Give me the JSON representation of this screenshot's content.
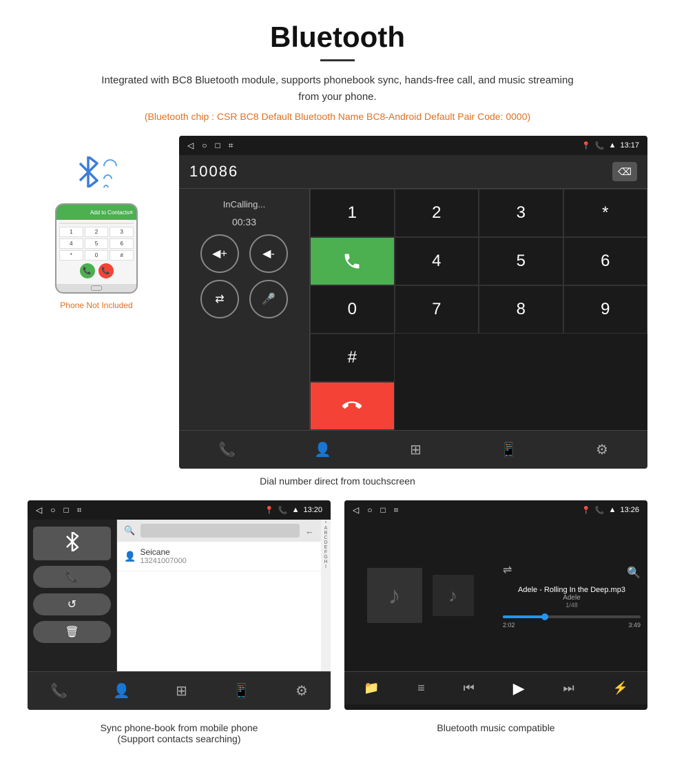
{
  "header": {
    "title": "Bluetooth",
    "description": "Integrated with BC8 Bluetooth module, supports phonebook sync, hands-free call, and music streaming from your phone.",
    "orange_info": "(Bluetooth chip : CSR BC8    Default Bluetooth Name BC8-Android    Default Pair Code: 0000)"
  },
  "phone_mockup": {
    "not_included_label": "Phone Not Included",
    "call_label": "Add to Contacts",
    "dial_keys": [
      "1",
      "2",
      "3",
      "4",
      "5",
      "6",
      "*",
      "0",
      "#"
    ]
  },
  "dialer_screen": {
    "time": "13:17",
    "number": "10086",
    "call_status": "InCalling...",
    "call_timer": "00:33",
    "keys": [
      "1",
      "2",
      "3",
      "*",
      "4",
      "5",
      "6",
      "0",
      "7",
      "8",
      "9",
      "#"
    ],
    "caption": "Dial number direct from touchscreen"
  },
  "phonebook_screen": {
    "time": "13:20",
    "search_placeholder": "Search",
    "contact_name": "Seicane",
    "contact_number": "13241007000",
    "alphabet": [
      "*",
      "A",
      "B",
      "C",
      "D",
      "E",
      "F",
      "G",
      "H",
      "I"
    ],
    "caption_line1": "Sync phone-book from mobile phone",
    "caption_line2": "(Support contacts searching)"
  },
  "music_screen": {
    "time": "13:26",
    "track_name": "Adele - Rolling In the Deep.mp3",
    "artist": "Adele",
    "track_position": "1/48",
    "time_current": "2:02",
    "time_total": "3:49",
    "caption": "Bluetooth music compatible"
  },
  "icons": {
    "bluetooth": "✶",
    "back": "◁",
    "home": "○",
    "recents": "□",
    "screenshot": "⌗",
    "volume_up": "◀+",
    "volume_down": "◀-",
    "transfer": "⇄",
    "mic": "🎤",
    "phone": "📞",
    "contacts": "👤",
    "dialpad": "⊞",
    "device": "📱",
    "settings": "⚙",
    "search": "🔍",
    "delete": "⌫",
    "shuffle": "⇌",
    "folder": "📁",
    "playlist": "≡",
    "prev": "⏮",
    "play": "▶",
    "next": "⏭",
    "equalizer": "⚡"
  }
}
